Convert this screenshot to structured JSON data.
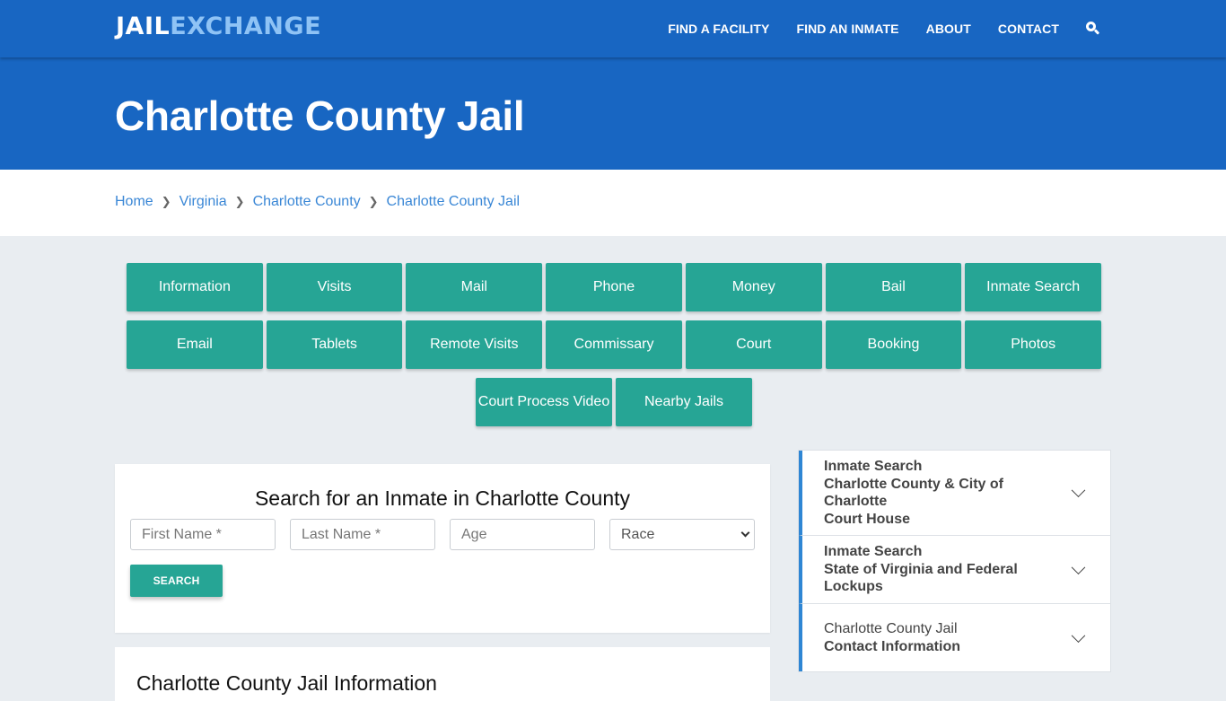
{
  "header": {
    "logo_part1": "JAIL",
    "logo_part2": "EXCHANGE",
    "nav": [
      "FIND A FACILITY",
      "FIND AN INMATE",
      "ABOUT",
      "CONTACT"
    ],
    "search_icon": "search-icon"
  },
  "hero": {
    "title": "Charlotte County Jail"
  },
  "breadcrumb": [
    "Home",
    "Virginia",
    "Charlotte County",
    "Charlotte County Jail"
  ],
  "tiles": {
    "row1": [
      "Information",
      "Visits",
      "Mail",
      "Phone",
      "Money",
      "Bail",
      "Inmate Search"
    ],
    "row2": [
      "Email",
      "Tablets",
      "Remote Visits",
      "Commissary",
      "Court",
      "Booking",
      "Photos"
    ],
    "row3": [
      "Court Process Video",
      "Nearby Jails"
    ]
  },
  "search": {
    "title": "Search for an Inmate in Charlotte County",
    "first_name_placeholder": "First Name *",
    "last_name_placeholder": "Last Name *",
    "age_placeholder": "Age",
    "race_selected": "Race",
    "button": "SEARCH"
  },
  "info": {
    "title": "Charlotte County Jail Information"
  },
  "accordion": [
    {
      "line1": "Inmate Search",
      "line2": "Charlotte County & City of Charlotte",
      "line3": "Court House"
    },
    {
      "line1": "Inmate Search",
      "line2": "State of Virginia and Federal Lockups"
    },
    {
      "line1": "Charlotte County Jail",
      "line2": "Contact Information"
    }
  ],
  "colors": {
    "brand_blue": "#1866c2",
    "teal": "#26a595",
    "link_blue": "#3a87d6",
    "accent_border": "#2f86d4"
  }
}
